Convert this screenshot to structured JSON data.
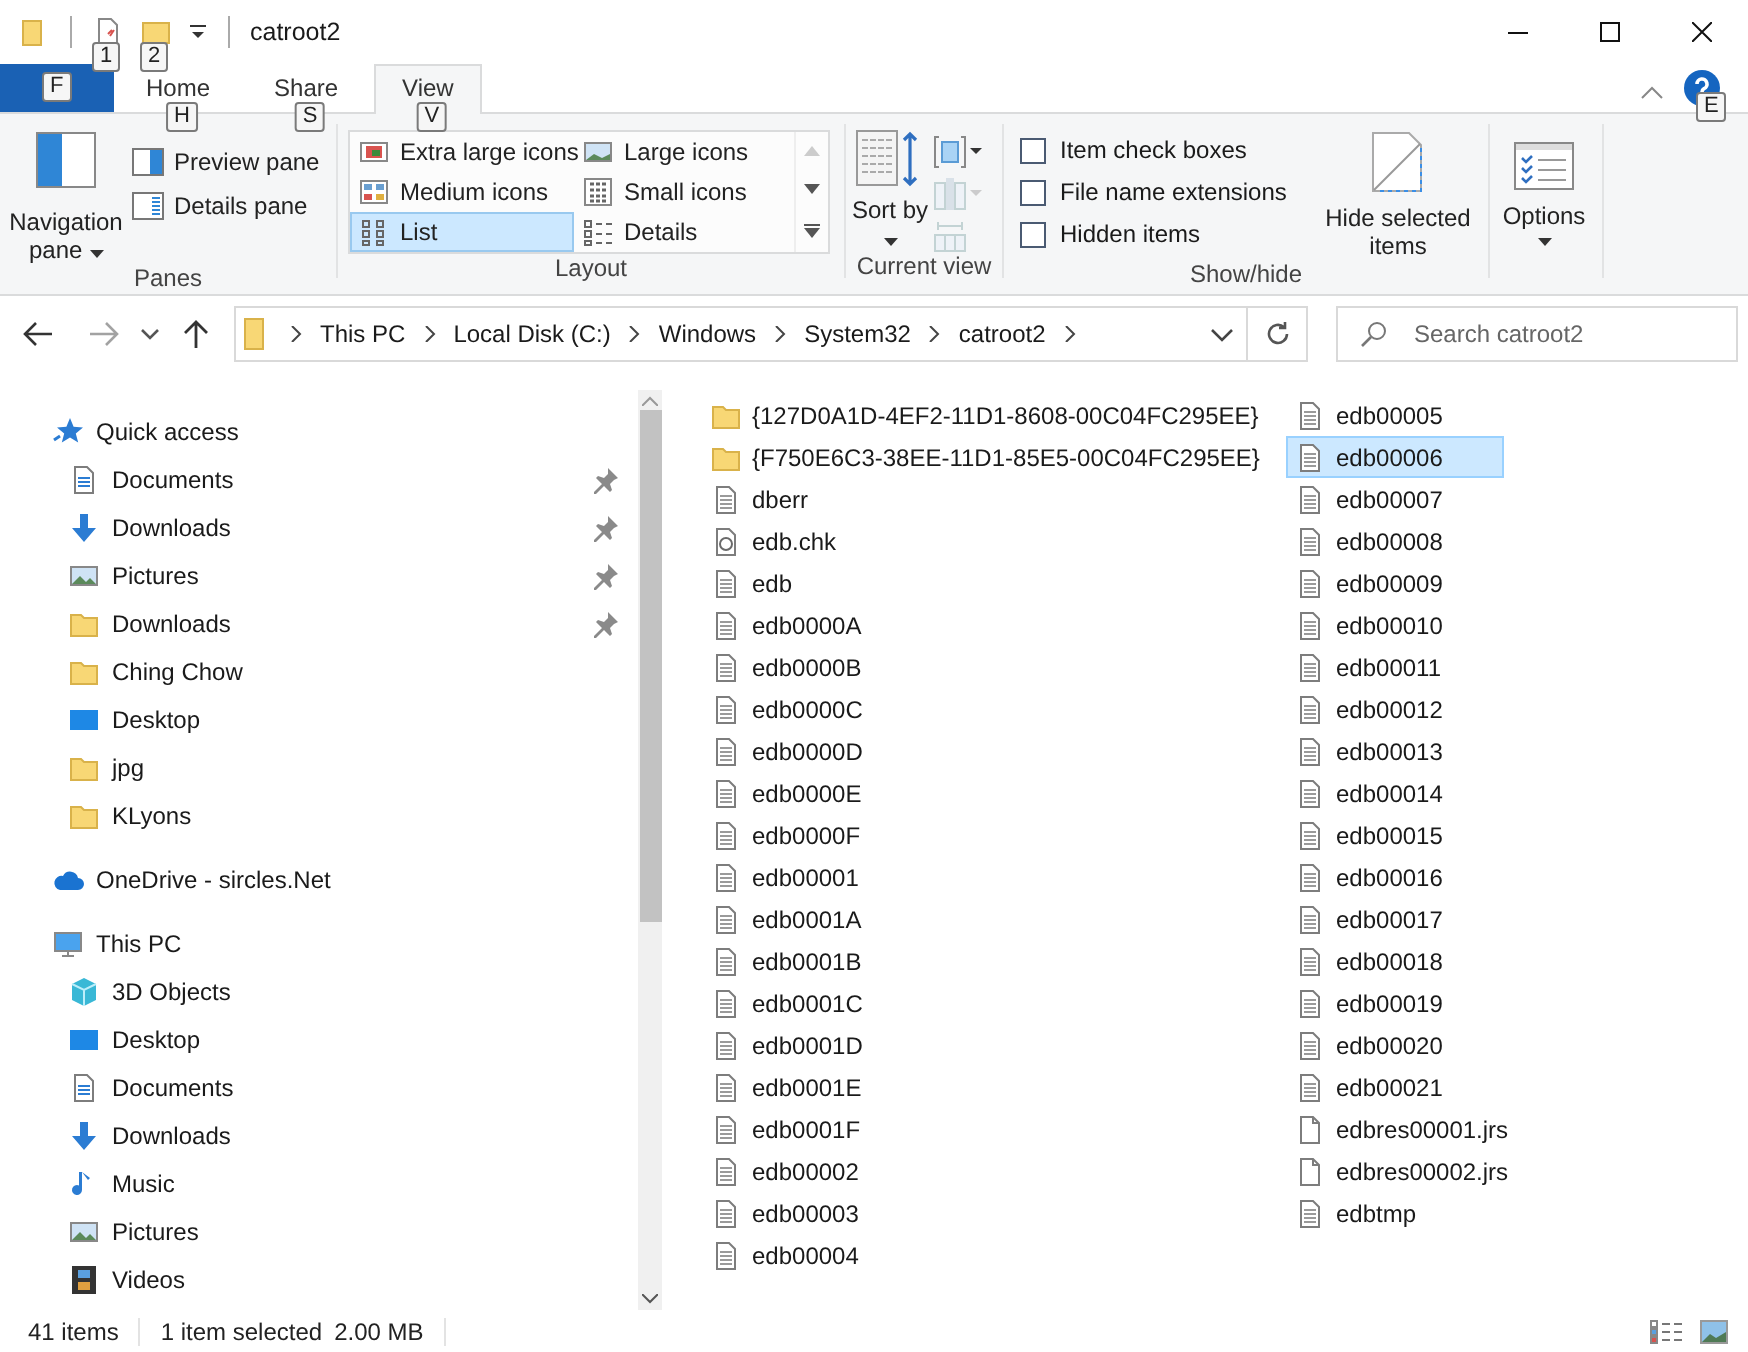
{
  "window": {
    "title": "catroot2"
  },
  "quick_access_toolbar": [
    {
      "kind": "properties",
      "keytip": "1"
    },
    {
      "kind": "new-folder",
      "keytip": "2"
    }
  ],
  "ribbon_tabs": [
    {
      "kind": "file",
      "keytip": "F",
      "selected": false
    },
    {
      "kind": "tab",
      "label": "Home",
      "keytip": "H",
      "selected": false
    },
    {
      "kind": "tab",
      "label": "Share",
      "keytip": "S",
      "selected": false
    },
    {
      "kind": "tab",
      "label": "View",
      "keytip": "V",
      "selected": true
    }
  ],
  "help": {
    "keytip": "E"
  },
  "ribbon": {
    "panes": {
      "label": "Panes",
      "navigation_pane": "Navigation pane",
      "buttons": [
        {
          "kind": "preview",
          "label": "Preview pane"
        },
        {
          "kind": "details",
          "label": "Details pane"
        }
      ]
    },
    "layout": {
      "label": "Layout",
      "options": [
        {
          "label": "Extra large icons",
          "kind": "extra-large",
          "selected": false
        },
        {
          "label": "Large icons",
          "kind": "large",
          "selected": false
        },
        {
          "label": "Medium icons",
          "kind": "medium",
          "selected": false
        },
        {
          "label": "Small icons",
          "kind": "small",
          "selected": false
        },
        {
          "label": "List",
          "kind": "list",
          "selected": true
        },
        {
          "label": "Details",
          "kind": "details",
          "selected": false
        }
      ]
    },
    "current_view": {
      "label": "Current view",
      "sort_by": "Sort by",
      "tools": [
        {
          "kind": "group-by",
          "disabled": false
        },
        {
          "kind": "add-columns",
          "disabled": true
        },
        {
          "kind": "size-columns",
          "disabled": true
        }
      ]
    },
    "show_hide": {
      "label": "Show/hide",
      "checkboxes": [
        {
          "label": "Item check boxes",
          "checked": false
        },
        {
          "label": "File name extensions",
          "checked": false
        },
        {
          "label": "Hidden items",
          "checked": false
        }
      ],
      "hide_selected": "Hide selected items"
    },
    "options": {
      "label": "Options"
    }
  },
  "history_buttons": [
    {
      "kind": "back",
      "disabled": false
    },
    {
      "kind": "forward",
      "disabled": true
    }
  ],
  "address_bar": {
    "breadcrumbs": [
      "This PC",
      "Local Disk (C:)",
      "Windows",
      "System32",
      "catroot2"
    ]
  },
  "search": {
    "placeholder": "Search catroot2"
  },
  "navigation": [
    {
      "label": "Quick access",
      "kind": "star",
      "children": [
        {
          "label": "Documents",
          "kind": "documents",
          "pinned": true
        },
        {
          "label": "Downloads",
          "kind": "downloads",
          "pinned": true
        },
        {
          "label": "Pictures",
          "kind": "pictures",
          "pinned": true
        },
        {
          "label": "Downloads",
          "kind": "folder",
          "pinned": true
        },
        {
          "label": "Ching Chow",
          "kind": "folder",
          "pinned": false
        },
        {
          "label": "Desktop",
          "kind": "desktop",
          "pinned": false
        },
        {
          "label": "jpg",
          "kind": "folder",
          "pinned": false
        },
        {
          "label": "KLyons",
          "kind": "folder",
          "pinned": false
        }
      ]
    },
    {
      "label": "OneDrive - sircles.Net",
      "kind": "cloud"
    },
    {
      "label": "This PC",
      "kind": "pc",
      "children": [
        {
          "label": "3D Objects",
          "kind": "cube",
          "pinned": false
        },
        {
          "label": "Desktop",
          "kind": "desktop",
          "pinned": false
        },
        {
          "label": "Documents",
          "kind": "documents",
          "pinned": false
        },
        {
          "label": "Downloads",
          "kind": "downloads",
          "pinned": false
        },
        {
          "label": "Music",
          "kind": "music",
          "pinned": false
        },
        {
          "label": "Pictures",
          "kind": "pictures",
          "pinned": false
        },
        {
          "label": "Videos",
          "kind": "videos",
          "pinned": false
        }
      ]
    }
  ],
  "files": [
    {
      "name": "{127D0A1D-4EF2-11D1-8608-00C04FC295EE}",
      "kind": "folder",
      "selected": false
    },
    {
      "name": "{F750E6C3-38EE-11D1-85E5-00C04FC295EE}",
      "kind": "folder",
      "selected": false
    },
    {
      "name": "dberr",
      "kind": "file",
      "selected": false
    },
    {
      "name": "edb.chk",
      "kind": "chk",
      "selected": false
    },
    {
      "name": "edb",
      "kind": "file",
      "selected": false
    },
    {
      "name": "edb0000A",
      "kind": "file",
      "selected": false
    },
    {
      "name": "edb0000B",
      "kind": "file",
      "selected": false
    },
    {
      "name": "edb0000C",
      "kind": "file",
      "selected": false
    },
    {
      "name": "edb0000D",
      "kind": "file",
      "selected": false
    },
    {
      "name": "edb0000E",
      "kind": "file",
      "selected": false
    },
    {
      "name": "edb0000F",
      "kind": "file",
      "selected": false
    },
    {
      "name": "edb00001",
      "kind": "file",
      "selected": false
    },
    {
      "name": "edb0001A",
      "kind": "file",
      "selected": false
    },
    {
      "name": "edb0001B",
      "kind": "file",
      "selected": false
    },
    {
      "name": "edb0001C",
      "kind": "file",
      "selected": false
    },
    {
      "name": "edb0001D",
      "kind": "file",
      "selected": false
    },
    {
      "name": "edb0001E",
      "kind": "file",
      "selected": false
    },
    {
      "name": "edb0001F",
      "kind": "file",
      "selected": false
    },
    {
      "name": "edb00002",
      "kind": "file",
      "selected": false
    },
    {
      "name": "edb00003",
      "kind": "file",
      "selected": false
    },
    {
      "name": "edb00004",
      "kind": "file",
      "selected": false
    },
    {
      "name": "edb00005",
      "kind": "file",
      "selected": false
    },
    {
      "name": "edb00006",
      "kind": "file",
      "selected": true
    },
    {
      "name": "edb00007",
      "kind": "file",
      "selected": false
    },
    {
      "name": "edb00008",
      "kind": "file",
      "selected": false
    },
    {
      "name": "edb00009",
      "kind": "file",
      "selected": false
    },
    {
      "name": "edb00010",
      "kind": "file",
      "selected": false
    },
    {
      "name": "edb00011",
      "kind": "file",
      "selected": false
    },
    {
      "name": "edb00012",
      "kind": "file",
      "selected": false
    },
    {
      "name": "edb00013",
      "kind": "file",
      "selected": false
    },
    {
      "name": "edb00014",
      "kind": "file",
      "selected": false
    },
    {
      "name": "edb00015",
      "kind": "file",
      "selected": false
    },
    {
      "name": "edb00016",
      "kind": "file",
      "selected": false
    },
    {
      "name": "edb00017",
      "kind": "file",
      "selected": false
    },
    {
      "name": "edb00018",
      "kind": "file",
      "selected": false
    },
    {
      "name": "edb00019",
      "kind": "file",
      "selected": false
    },
    {
      "name": "edb00020",
      "kind": "file",
      "selected": false
    },
    {
      "name": "edb00021",
      "kind": "file",
      "selected": false
    },
    {
      "name": "edbres00001.jrs",
      "kind": "blank",
      "selected": false
    },
    {
      "name": "edbres00002.jrs",
      "kind": "blank",
      "selected": false
    },
    {
      "name": "edbtmp",
      "kind": "file",
      "selected": false
    }
  ],
  "status_bar": {
    "item_count": "41 items",
    "selection": "1 item selected",
    "size": "2.00 MB"
  }
}
